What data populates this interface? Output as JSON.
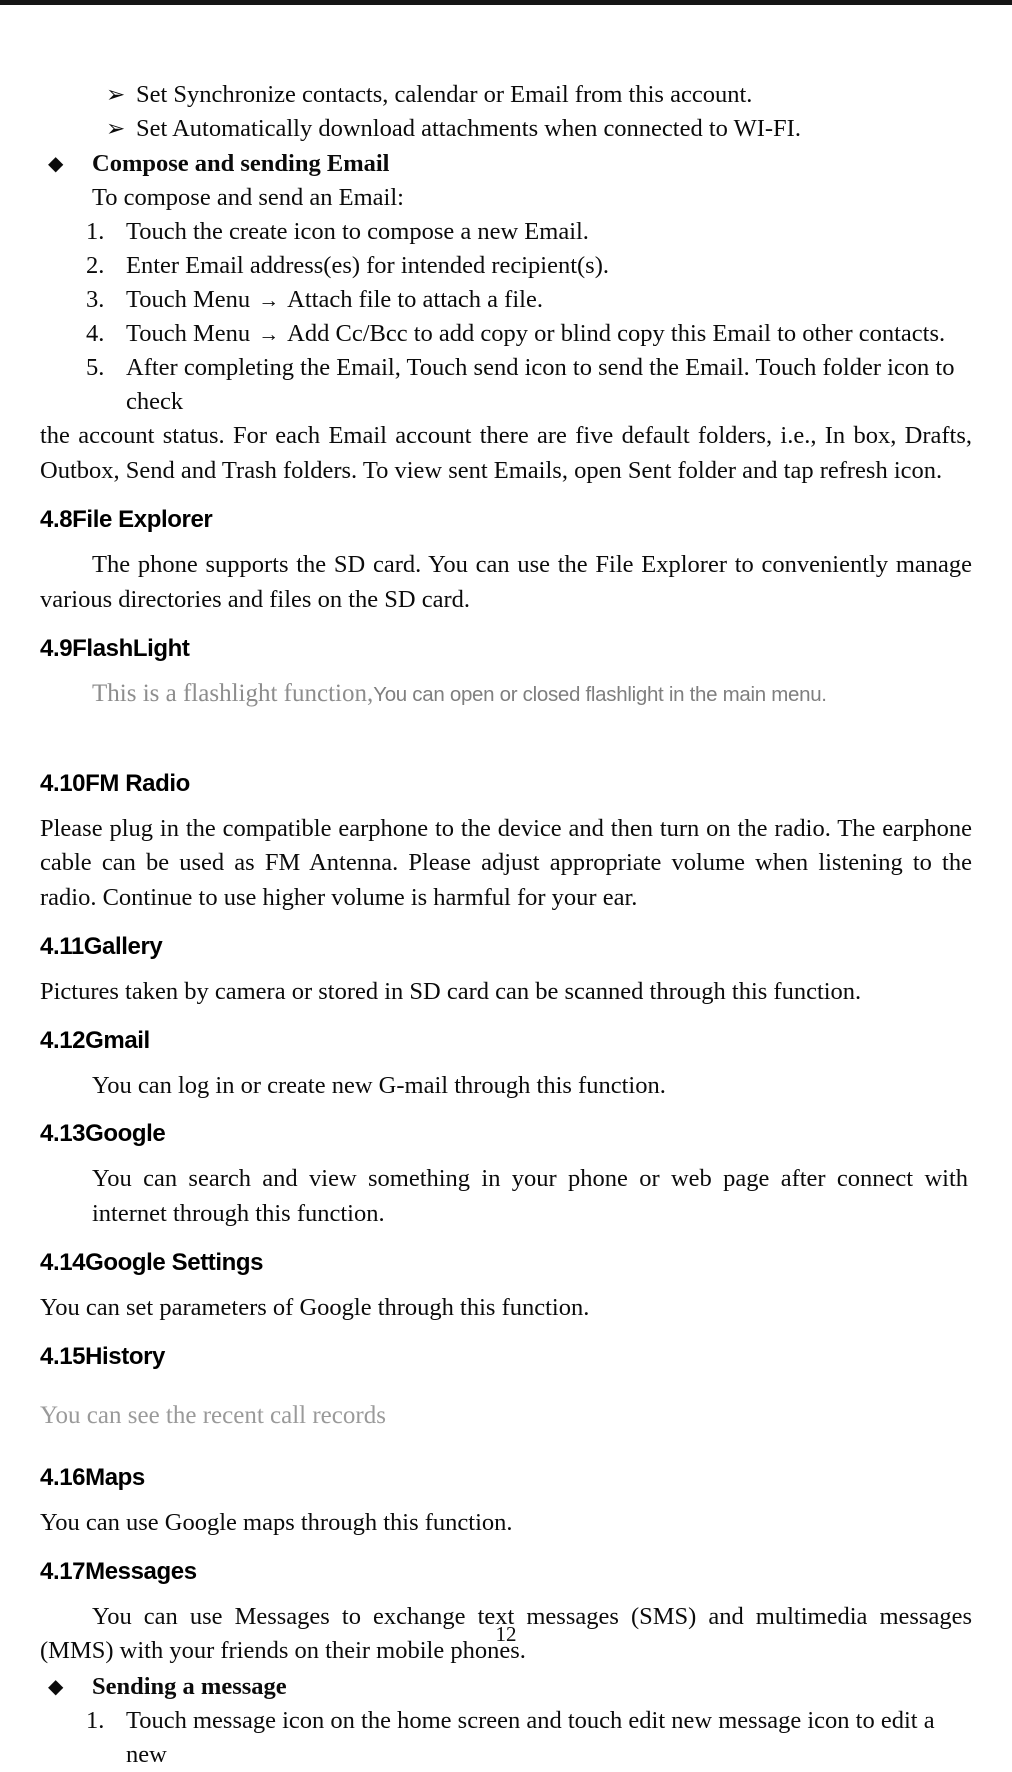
{
  "document": {
    "page_number": "12",
    "top_edge_color": "#151515",
    "body_text_color": "#0b0b0b",
    "faded_text_color": "#8d8d8d"
  },
  "email_section": {
    "sub_bullets": [
      {
        "marker": "➢",
        "text": "Set Synchronize contacts, calendar or Email from this account."
      },
      {
        "marker": "➢",
        "text": "Set Automatically download attachments when connected to WI-FI."
      }
    ],
    "compose_heading": {
      "marker": "◆",
      "text": "Compose and sending Email"
    },
    "compose_intro": "To compose and send an Email:",
    "steps": [
      {
        "num": "1.",
        "text": "Touch the create icon to compose a new Email."
      },
      {
        "num": "2.",
        "text": "Enter Email address(es) for intended recipient(s)."
      },
      {
        "num": "3.",
        "pre": "Touch Menu",
        "arrow": "→",
        "post": "Attach file to attach a file."
      },
      {
        "num": "4.",
        "pre": "Touch Menu",
        "arrow": "→",
        "post": "Add Cc/Bcc to add copy or blind copy this Email to other contacts."
      },
      {
        "num": "5.",
        "text": "After completing the Email, Touch send icon to send the Email. Touch folder icon to check"
      }
    ],
    "step5_continuation": "the account status. For each Email account there are five default folders, i.e., In box, Drafts, Outbox, Send and Trash folders. To view sent Emails, open Sent folder and tap refresh icon."
  },
  "sections": [
    {
      "id": "file-explorer",
      "heading": "4.8File Explorer",
      "body": "The phone supports the SD card. You can use the File Explorer to conveniently manage various directories and files on the SD card."
    },
    {
      "id": "flashlight",
      "heading": "4.9FlashLight",
      "body_serif_faded": "This is a flashlight function,",
      "body_sans_faded": "You can open or closed flashlight in the main menu."
    },
    {
      "id": "fm-radio",
      "heading": "4.10FM Radio",
      "body": "Please plug in the compatible earphone to the device and then turn on the radio. The earphone cable can be used as FM Antenna. Please adjust appropriate volume when listening to the radio. Continue to use higher volume is harmful for your ear."
    },
    {
      "id": "gallery",
      "heading": "4.11Gallery",
      "body": "Pictures taken by camera or stored in SD card can be scanned through this function."
    },
    {
      "id": "gmail",
      "heading": "4.12Gmail",
      "body": "You can log in or create new G-mail through this function."
    },
    {
      "id": "google",
      "heading": "4.13Google",
      "body": "You can search and view something in your phone or web page after connect with internet through this function."
    },
    {
      "id": "google-settings",
      "heading": "4.14Google Settings",
      "body": "You can set parameters of Google through this function."
    },
    {
      "id": "history",
      "heading": "4.15History",
      "body": "You can see the recent call records"
    },
    {
      "id": "maps",
      "heading": "4.16Maps",
      "body": "You can use Google maps through this function."
    },
    {
      "id": "messages",
      "heading": "4.17Messages",
      "body": "You can use Messages to exchange text messages (SMS) and multimedia messages (MMS) with your friends on their mobile phones.",
      "sending_heading": {
        "marker": "◆",
        "text": "Sending a message"
      },
      "steps": [
        {
          "num": "1.",
          "text": "Touch message icon on the home screen and touch edit new message icon to edit a new"
        }
      ]
    }
  ]
}
